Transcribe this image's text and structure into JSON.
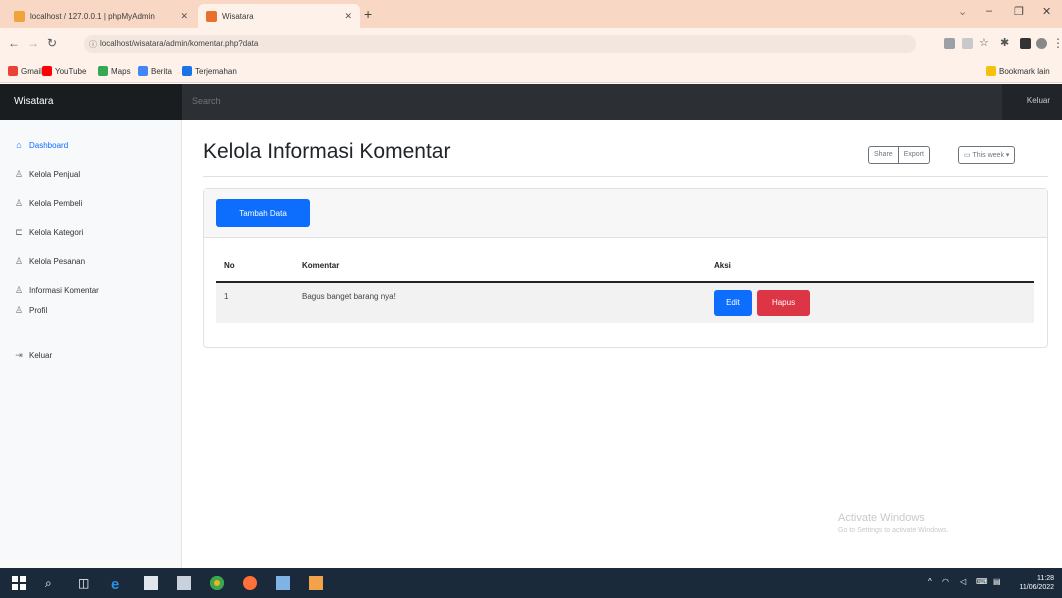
{
  "browser": {
    "tabs": [
      {
        "title": "localhost / 127.0.0.1 | phpMyAdmin",
        "favicon": "phpmyadmin-favicon"
      },
      {
        "title": "Wisatara",
        "favicon": "wisatara-favicon"
      }
    ],
    "new_tab": "+",
    "url": "localhost/wisatara/admin/komentar.php?data",
    "bookmarks": [
      "Gmail",
      "YouTube",
      "Maps",
      "Berita",
      "Terjemahan"
    ],
    "bookmarks_other": "Bookmark lain",
    "window_controls": {
      "minimize": "–",
      "maximize": "❐",
      "close": "✕"
    }
  },
  "navbar": {
    "brand": "Wisatara",
    "search_placeholder": "Search",
    "signout": "Keluar"
  },
  "sidebar": {
    "items": [
      {
        "label": "Dashboard",
        "icon": "home-icon",
        "active": true
      },
      {
        "label": "Kelola Penjual",
        "icon": "user-icon"
      },
      {
        "label": "Kelola Pembeli",
        "icon": "user-icon"
      },
      {
        "label": "Kelola Kategori",
        "icon": "tag-icon"
      },
      {
        "label": "Kelola Pesanan",
        "icon": "users-icon"
      },
      {
        "label": "Informasi Komentar",
        "icon": "users-icon"
      },
      {
        "label": "Profil",
        "icon": "user-icon"
      },
      {
        "label": "Keluar",
        "icon": "logout-icon"
      }
    ]
  },
  "main": {
    "title": "Kelola Informasi Komentar",
    "toolbar": {
      "share": "Share",
      "export": "Export",
      "period": "This week"
    },
    "add_button": "Tambah Data",
    "table": {
      "headers": [
        "No",
        "Komentar",
        "Aksi"
      ],
      "rows": [
        {
          "no": "1",
          "komentar": "Bagus banget barang nya!",
          "edit": "Edit",
          "hapus": "Hapus"
        }
      ]
    }
  },
  "watermark": {
    "line1": "Activate Windows",
    "line2": "Go to Settings to activate Windows."
  },
  "taskbar": {
    "time": "11:28",
    "date": "11/06/2022"
  },
  "colors": {
    "primary": "#0d6efd",
    "danger": "#dc3545",
    "navbar": "#212529",
    "tabstrip": "#f8d7c4"
  }
}
